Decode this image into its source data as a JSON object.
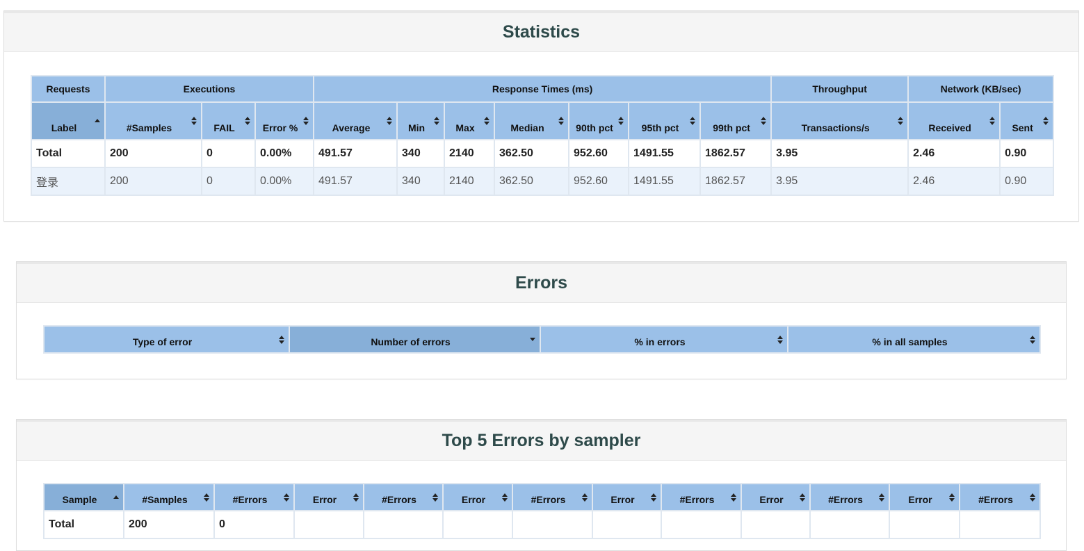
{
  "statistics": {
    "title": "Statistics",
    "groups": [
      "Requests",
      "Executions",
      "Response Times (ms)",
      "Throughput",
      "Network (KB/sec)"
    ],
    "columns": [
      "Label",
      "#Samples",
      "FAIL",
      "Error %",
      "Average",
      "Min",
      "Max",
      "Median",
      "90th pct",
      "95th pct",
      "99th pct",
      "Transactions/s",
      "Received",
      "Sent"
    ],
    "rows": [
      [
        "Total",
        "200",
        "0",
        "0.00%",
        "491.57",
        "340",
        "2140",
        "362.50",
        "952.60",
        "1491.55",
        "1862.57",
        "3.95",
        "2.46",
        "0.90"
      ],
      [
        "登录",
        "200",
        "0",
        "0.00%",
        "491.57",
        "340",
        "2140",
        "362.50",
        "952.60",
        "1491.55",
        "1862.57",
        "3.95",
        "2.46",
        "0.90"
      ]
    ]
  },
  "errors": {
    "title": "Errors",
    "columns": [
      "Type of error",
      "Number of errors",
      "% in errors",
      "% in all samples"
    ]
  },
  "top5": {
    "title": "Top 5 Errors by sampler",
    "columns": [
      "Sample",
      "#Samples",
      "#Errors",
      "Error",
      "#Errors",
      "Error",
      "#Errors",
      "Error",
      "#Errors",
      "Error",
      "#Errors",
      "Error",
      "#Errors"
    ],
    "rows": [
      [
        "Total",
        "200",
        "0",
        "",
        "",
        "",
        "",
        "",
        "",
        "",
        "",
        "",
        ""
      ]
    ]
  }
}
